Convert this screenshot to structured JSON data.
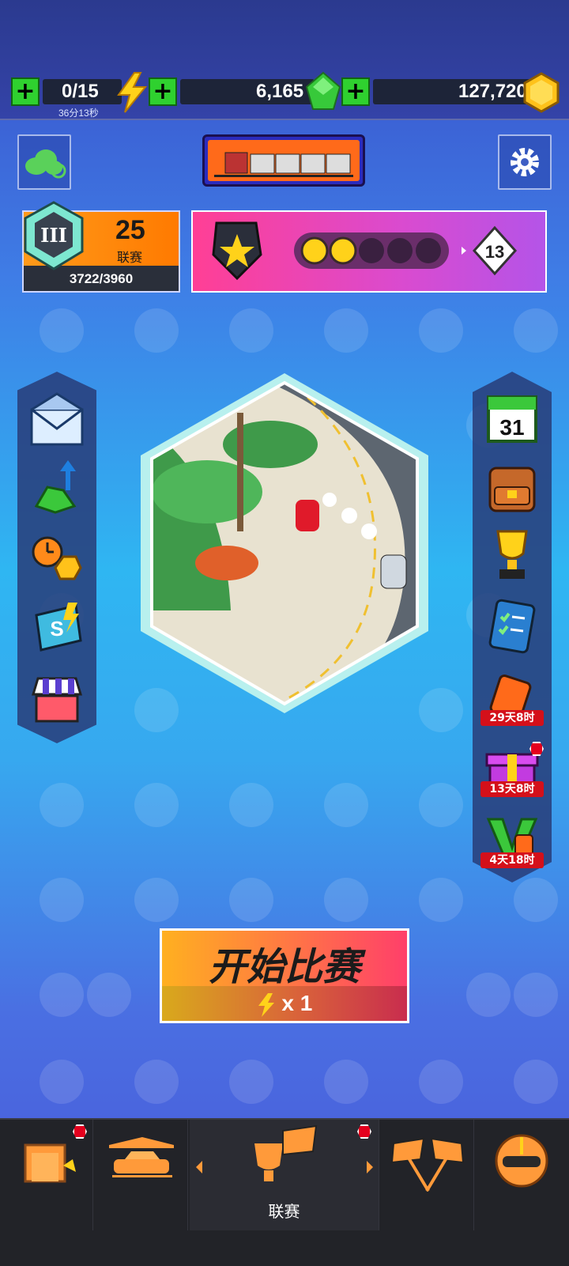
{
  "currencies": {
    "energy": {
      "value": "0/15",
      "timer": "36分13秒",
      "icon": "lightning-bolt-icon"
    },
    "gems": {
      "value": "6,165",
      "icon": "green-gem-icon"
    },
    "coins": {
      "value": "127,720",
      "icon": "gold-hex-coin-icon"
    }
  },
  "league": {
    "level": "25",
    "label": "联赛",
    "progress": "3722/3960",
    "rank_badge": "III"
  },
  "promo": {
    "stars_filled": 2,
    "stars_total": 5,
    "reward": "13"
  },
  "left_menu": [
    {
      "icon": "mail-icon"
    },
    {
      "icon": "gem-upgrade-icon"
    },
    {
      "icon": "timed-coins-icon"
    },
    {
      "icon": "super-card-icon"
    },
    {
      "icon": "shop-icon"
    }
  ],
  "right_menu": [
    {
      "icon": "calendar-icon",
      "label": "31"
    },
    {
      "icon": "backpack-icon"
    },
    {
      "icon": "trophy-icon"
    },
    {
      "icon": "checklist-icon"
    },
    {
      "icon": "fuel-can-icon",
      "timer": "29天8时"
    },
    {
      "icon": "gift-icon",
      "timer": "13天8时"
    },
    {
      "icon": "v-pass-icon",
      "timer": "4天18时"
    }
  ],
  "start": {
    "label": "开始比赛",
    "cost": "x 1"
  },
  "nav": {
    "active_label": "联赛"
  },
  "colors": {
    "accent_orange": "#ff7a00",
    "plus_green": "#2fd12f",
    "timer_red": "#d4101a"
  }
}
